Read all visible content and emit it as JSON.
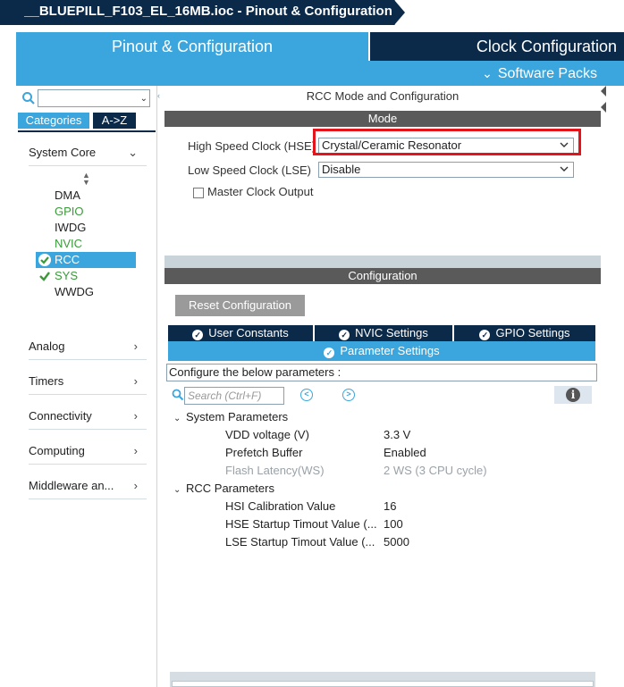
{
  "titlebar": {
    "tab_title": "__BLUEPILL_F103_EL_16MB.ioc - Pinout & Configuration"
  },
  "header": {
    "pinout_tab": "Pinout & Configuration",
    "clock_tab": "Clock Configuration",
    "software_packs": "Software Packs",
    "colors": {
      "primary": "#3aa6dd",
      "dark": "#0b2a4a"
    }
  },
  "left": {
    "search": {
      "placeholder": ""
    },
    "tabs": {
      "categories": "Categories",
      "atoz": "A->Z"
    },
    "sections": {
      "system_core": "System Core",
      "analog": "Analog",
      "timers": "Timers",
      "connectivity": "Connectivity",
      "computing": "Computing",
      "middleware": "Middleware an..."
    },
    "items": [
      "DMA",
      "GPIO",
      "IWDG",
      "NVIC",
      "RCC",
      "SYS",
      "WWDG"
    ]
  },
  "main": {
    "mode_title": "RCC Mode and Configuration",
    "mode_bar": "Mode",
    "hse_label": "High Speed Clock (HSE)",
    "hse_value": "Crystal/Ceramic Resonator",
    "lse_label": "Low Speed Clock (LSE)",
    "lse_value": "Disable",
    "mco_label": "Master Clock Output",
    "config_bar": "Configuration",
    "reset_button": "Reset Configuration",
    "tabs": {
      "user_constants": "User Constants",
      "nvic_settings": "NVIC Settings",
      "gpio_settings": "GPIO Settings",
      "parameter_settings": "Parameter Settings"
    },
    "hint": "Configure the below parameters :",
    "search_placeholder": "Search (Ctrl+F)",
    "groups": {
      "system": {
        "label": "System Parameters",
        "rows": [
          {
            "name": "VDD voltage (V)",
            "value": "3.3 V"
          },
          {
            "name": "Prefetch Buffer",
            "value": "Enabled"
          },
          {
            "name": "Flash Latency(WS)",
            "value": "2 WS (3 CPU cycle)"
          }
        ]
      },
      "rcc": {
        "label": "RCC Parameters",
        "rows": [
          {
            "name": "HSI Calibration Value",
            "value": "16"
          },
          {
            "name": "HSE Startup Timout Value (...",
            "value": "100"
          },
          {
            "name": "LSE Startup Timout Value (...",
            "value": "5000"
          }
        ]
      }
    }
  }
}
